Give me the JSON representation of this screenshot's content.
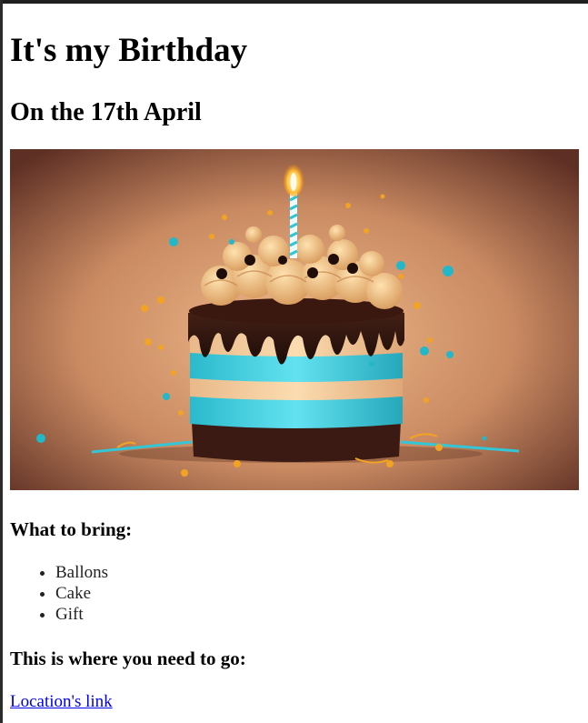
{
  "page": {
    "title": "It's my Birthday",
    "subtitle": "On the 17th April"
  },
  "image": {
    "subject": "birthday-cake-with-candle"
  },
  "bring": {
    "heading": "What to bring:",
    "items": [
      "Ballons",
      "Cake",
      "Gift"
    ]
  },
  "location": {
    "heading": "This is where you need to go:",
    "link_text": "Location's link"
  },
  "colors": {
    "link": "#0000ee",
    "cake_blue": "#3fd0e0",
    "cake_cream": "#f6cf9c",
    "chocolate": "#2a1410",
    "background_warm": "#c88a62"
  }
}
